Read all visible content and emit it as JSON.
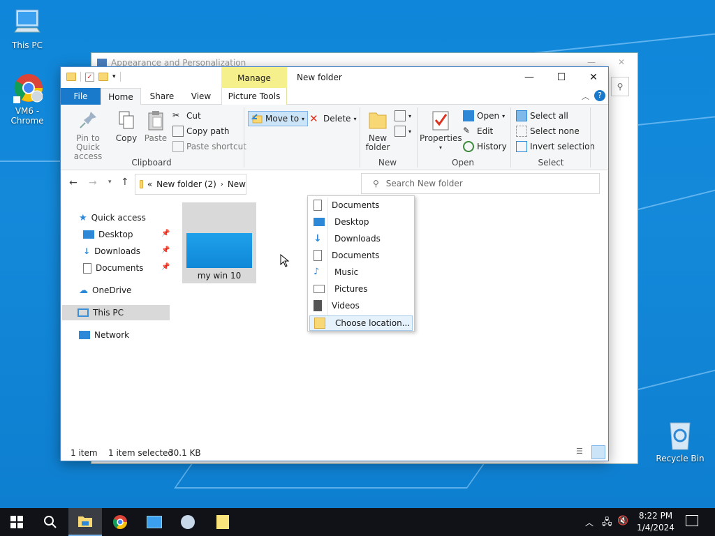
{
  "desktop": {
    "icons": [
      {
        "label": "This PC"
      },
      {
        "label": "VM6 - Chrome"
      },
      {
        "label": "Recycle Bin"
      }
    ]
  },
  "back_window": {
    "title": "Appearance and Personalization"
  },
  "window": {
    "title": "New folder",
    "manage_tab": "Manage",
    "tabs": {
      "file": "File",
      "home": "Home",
      "share": "Share",
      "view": "View",
      "picture_tools": "Picture Tools"
    },
    "ribbon": {
      "clipboard": {
        "label": "Clipboard",
        "pin": "Pin to Quick access",
        "copy": "Copy",
        "paste": "Paste",
        "cut": "Cut",
        "copy_path": "Copy path",
        "paste_shortcut": "Paste shortcut"
      },
      "organize": {
        "move_to": "Move to",
        "delete": "Delete"
      },
      "new": {
        "label": "New",
        "new_folder_line1": "New",
        "new_folder_line2": "folder"
      },
      "open": {
        "label": "Open",
        "properties": "Properties",
        "open": "Open",
        "edit": "Edit",
        "history": "History"
      },
      "select": {
        "label": "Select",
        "select_all": "Select all",
        "select_none": "Select none",
        "invert": "Invert selection"
      }
    },
    "address": {
      "prefix": "«",
      "crumb1": "New folder (2)",
      "crumb2": "New"
    },
    "search": {
      "placeholder": "Search New folder"
    },
    "nav": {
      "quick_access": "Quick access",
      "desktop": "Desktop",
      "downloads": "Downloads",
      "documents": "Documents",
      "onedrive": "OneDrive",
      "this_pc": "This PC",
      "network": "Network"
    },
    "files": [
      {
        "name": "my win 10"
      }
    ],
    "status": {
      "count": "1 item",
      "selected": "1 item selected",
      "size": "30.1 KB"
    },
    "move_to_menu": [
      {
        "label": "Documents",
        "icon": "document-icon"
      },
      {
        "label": "Desktop",
        "icon": "desktop-icon"
      },
      {
        "label": "Downloads",
        "icon": "download-icon"
      },
      {
        "label": "Documents",
        "icon": "document-icon"
      },
      {
        "label": "Music",
        "icon": "music-icon"
      },
      {
        "label": "Pictures",
        "icon": "pictures-icon"
      },
      {
        "label": "Videos",
        "icon": "video-icon"
      },
      {
        "label": "Choose location...",
        "icon": "folder-icon"
      }
    ]
  },
  "taskbar": {
    "time": "8:22 PM",
    "date": "1/4/2024"
  },
  "colors": {
    "accent": "#1979ca",
    "manage": "#f6f08c",
    "desktop": "#1489da",
    "taskbar": "#101217"
  }
}
